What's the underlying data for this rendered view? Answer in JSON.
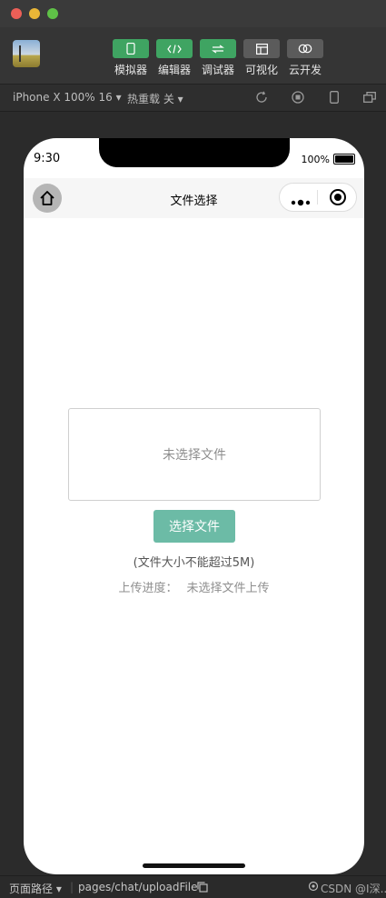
{
  "window": {
    "traffic_lights": {
      "close": "#ec5f57",
      "minimize": "#e9b637",
      "maximize": "#5fc147"
    }
  },
  "toolbar": {
    "tools": [
      {
        "id": "simulator",
        "label": "模拟器",
        "icon": "phone-icon",
        "color": "#3fa462"
      },
      {
        "id": "editor",
        "label": "编辑器",
        "icon": "code-icon",
        "color": "#3fa462"
      },
      {
        "id": "debugger",
        "label": "调试器",
        "icon": "swap-icon",
        "color": "#3fa462"
      },
      {
        "id": "visual",
        "label": "可视化",
        "icon": "layout-icon",
        "color": "#5b5b5b"
      },
      {
        "id": "cloud",
        "label": "云开发",
        "icon": "cloud-icon",
        "color": "#5b5b5b"
      }
    ]
  },
  "subbar": {
    "device_selector": "iPhone X 100% 16",
    "hot_reload": "热重载 关"
  },
  "phone": {
    "status": {
      "time": "9:30",
      "battery": "100%"
    },
    "nav_title": "文件选择",
    "file_box_placeholder": "未选择文件",
    "choose_button": "选择文件",
    "size_note": "(文件大小不能超过5M)",
    "progress_label": "上传进度：",
    "progress_value": "未选择文件上传"
  },
  "colors": {
    "primary_button": "#6cbba6",
    "tool_active": "#3fa462"
  },
  "statusbar": {
    "page_path_label": "页面路径",
    "page_path": "pages/chat/uploadFile",
    "watermark": "CSDN @I深..."
  }
}
